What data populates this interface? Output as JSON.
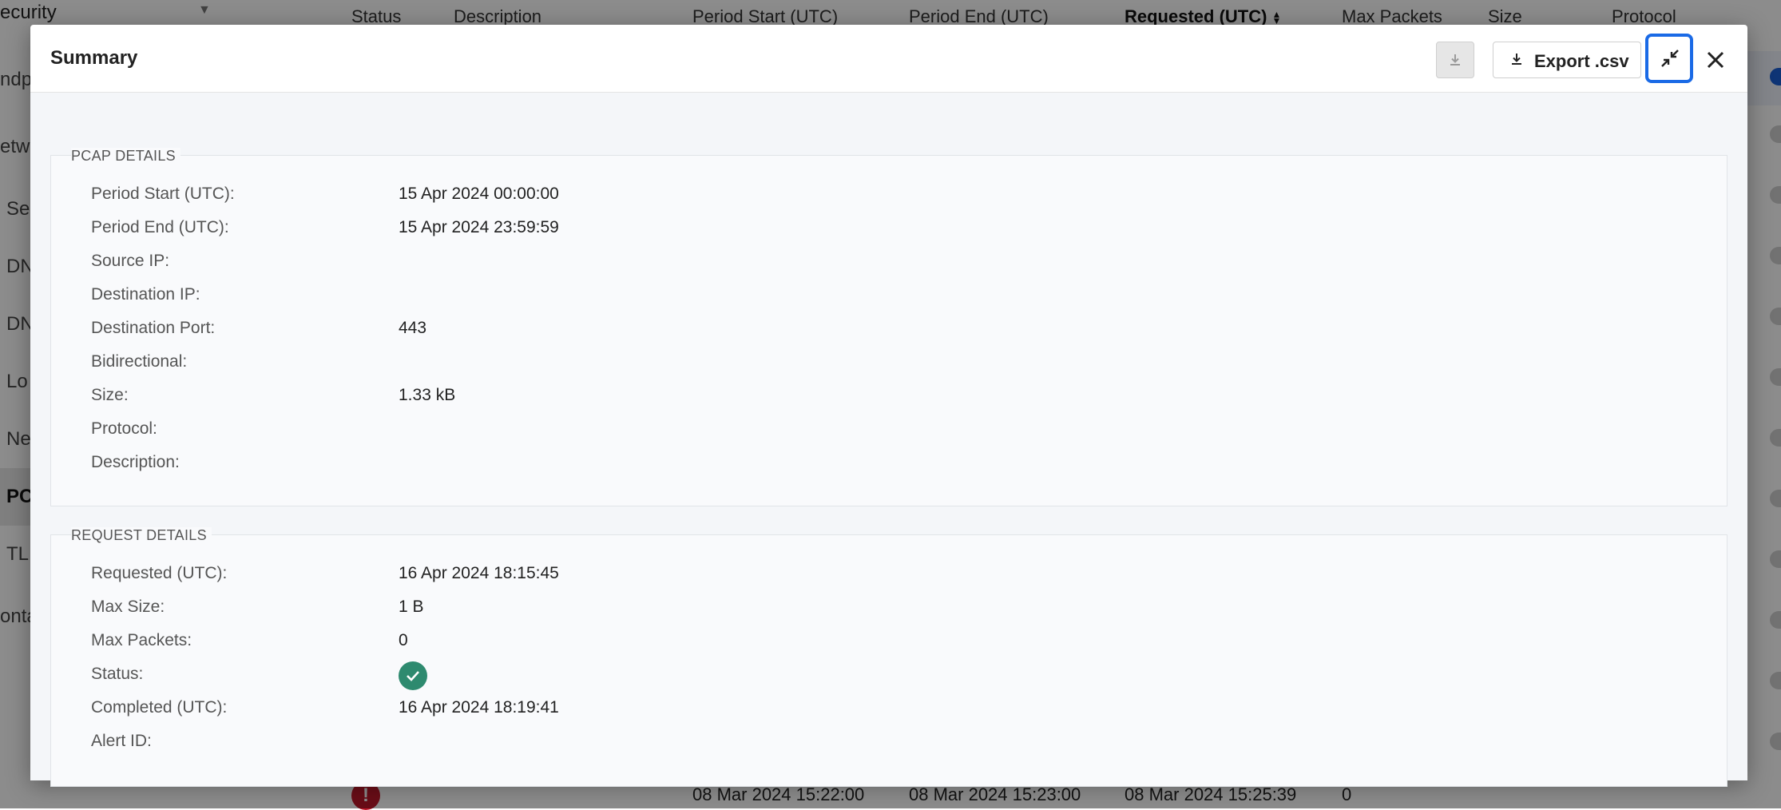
{
  "sidebar": {
    "top_label": "ecurity",
    "items": [
      {
        "label": "ndp"
      },
      {
        "label": "etw"
      },
      {
        "label": "Se"
      },
      {
        "label": "DN"
      },
      {
        "label": "DN"
      },
      {
        "label": "Lo"
      },
      {
        "label": "Ne"
      },
      {
        "label": "PC"
      },
      {
        "label": "TL"
      },
      {
        "label": "onta"
      }
    ]
  },
  "table": {
    "headers": {
      "status": "Status",
      "description": "Description",
      "period_start": "Period Start (UTC)",
      "period_end": "Period End (UTC)",
      "requested": "Requested (UTC)",
      "max_packets": "Max Packets",
      "size": "Size",
      "protocol": "Protocol"
    },
    "visible_row": {
      "period_start": "08 Mar 2024 15:22:00",
      "period_end": "08 Mar 2024 15:23:00",
      "requested": "08 Mar 2024 15:25:39",
      "max_packets": "0",
      "status_icon": "error-icon"
    }
  },
  "modal": {
    "title": "Summary",
    "export_label": "Export .csv",
    "pcap_section": {
      "title": "PCAP DETAILS",
      "fields": [
        {
          "label": "Period Start (UTC):",
          "value": "15 Apr 2024 00:00:00"
        },
        {
          "label": "Period End (UTC):",
          "value": "15 Apr 2024 23:59:59"
        },
        {
          "label": "Source IP:",
          "value": ""
        },
        {
          "label": "Destination IP:",
          "value": ""
        },
        {
          "label": "Destination Port:",
          "value": "443"
        },
        {
          "label": "Bidirectional:",
          "value": ""
        },
        {
          "label": "Size:",
          "value": "1.33 kB"
        },
        {
          "label": "Protocol:",
          "value": ""
        },
        {
          "label": "Description:",
          "value": ""
        }
      ]
    },
    "request_section": {
      "title": "REQUEST DETAILS",
      "fields": [
        {
          "label": "Requested (UTC):",
          "value": "16 Apr 2024 18:15:45"
        },
        {
          "label": "Max Size:",
          "value": "1 B"
        },
        {
          "label": "Max Packets:",
          "value": "0"
        },
        {
          "label": "Status:",
          "value": "",
          "icon": "check-circle-icon"
        },
        {
          "label": "Completed (UTC):",
          "value": "16 Apr 2024 18:19:41"
        },
        {
          "label": "Alert ID:",
          "value": ""
        }
      ]
    }
  },
  "colors": {
    "accent": "#1a6ae6",
    "success": "#2e8a6f",
    "error": "#c0182a"
  }
}
